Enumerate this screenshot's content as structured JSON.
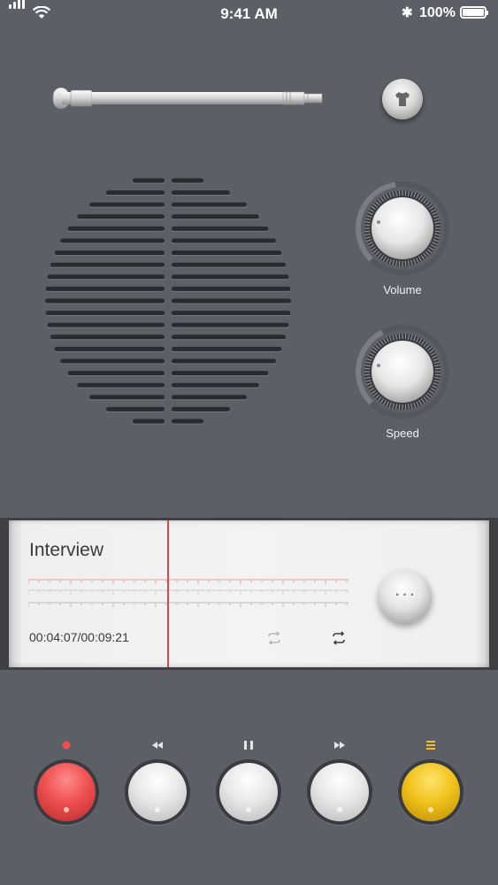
{
  "status_bar": {
    "time": "9:41 AM",
    "battery": "100%",
    "battery_level": 1.0
  },
  "knobs": {
    "volume": {
      "label": "Volume",
      "level": 0.35
    },
    "speed": {
      "label": "Speed",
      "level": 0.3
    }
  },
  "track": {
    "title": "Interview",
    "time": "00:04:07/00:09:21",
    "more_label": "···"
  },
  "controls": [
    {
      "name": "record",
      "icon": "record-icon",
      "cap": "red"
    },
    {
      "name": "rewind",
      "icon": "rewind-icon",
      "cap": "white"
    },
    {
      "name": "pause",
      "icon": "pause-icon",
      "cap": "white"
    },
    {
      "name": "fast-forward",
      "icon": "fast-forward-icon",
      "cap": "white"
    },
    {
      "name": "menu",
      "icon": "menu-icon",
      "cap": "yellow"
    }
  ],
  "colors": {
    "background": "#5d5f66",
    "record": "#ee4f4f",
    "menu": "#f0c21b",
    "playhead": "#d64a4a"
  }
}
